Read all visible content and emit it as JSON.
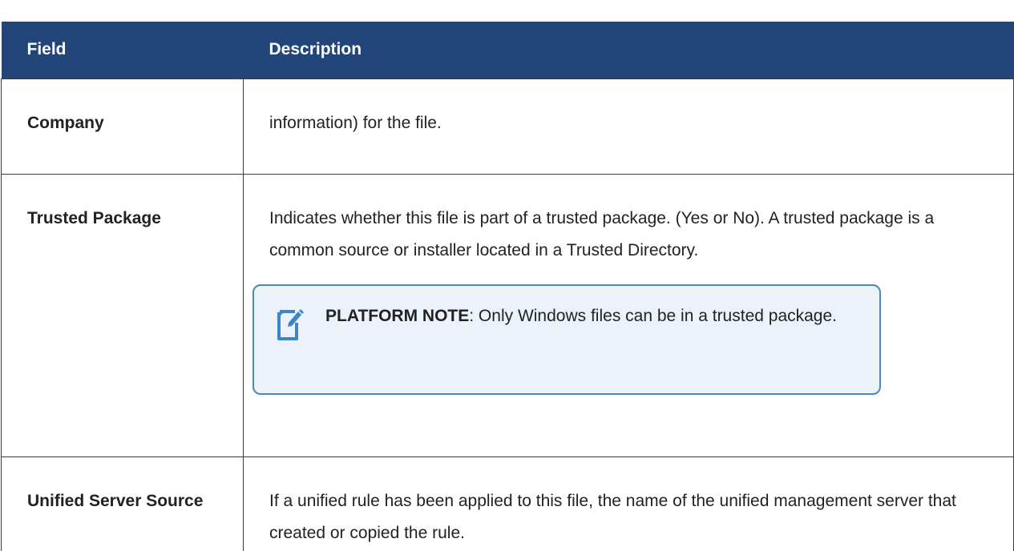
{
  "table": {
    "headers": {
      "field": "Field",
      "description": "Description"
    },
    "rows": [
      {
        "field": "Company",
        "description": "information) for the file."
      },
      {
        "field": "Trusted Package",
        "description": "Indicates whether this file is part of a trusted package. (Yes or No). A trusted package is a common source or installer located in a Trusted Directory.",
        "note": {
          "label": "PLATFORM NOTE",
          "text": ": Only Windows files can be in a trusted package.",
          "icon": "edit-note-icon"
        }
      },
      {
        "field": "Unified Server Source",
        "description": "If a unified rule has been applied to this file, the name of the unified management server that created or copied the rule."
      }
    ]
  },
  "colors": {
    "header_bg": "#22467a",
    "note_border": "#4a86c0",
    "note_bg": "#ebf2f9"
  }
}
